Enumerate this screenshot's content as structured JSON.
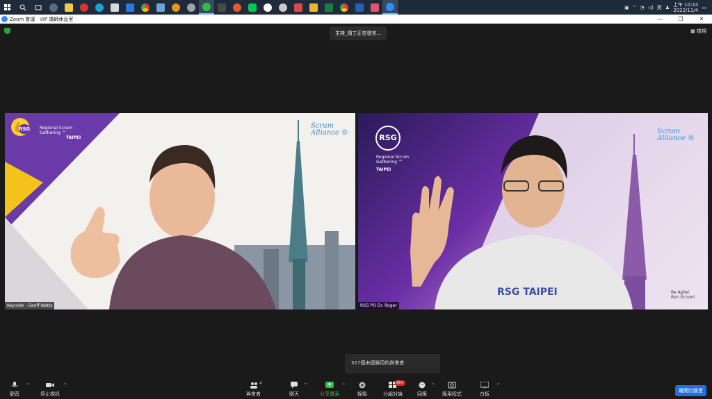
{
  "tray": {
    "time": "上午 10:14",
    "date": "2022/11/4"
  },
  "window": {
    "title": "Zoom 會議 · VIP 講師休息室"
  },
  "meeting": {
    "speaking_toast": "主持_領丁正在發言...",
    "view_label": "檢視",
    "participants": [
      {
        "name": "Keynote - Geoff Watts",
        "brand_line1": "Regional Scrum",
        "brand_line2": "Gathering ™",
        "brand_city": "TAIPEI",
        "logo_text": "RSG"
      },
      {
        "name": "RSG PO Dr. Roger",
        "brand_line1": "Regional Scrum",
        "brand_line2": "Gathering ™",
        "brand_city": "TAIPEI",
        "logo_text": "RSG",
        "slogan1": "Be Agile!",
        "slogan2": "Run Scrum!",
        "shirt_text": "RSG TAIPEI"
      }
    ],
    "partner_logo": {
      "line1": "Scrum",
      "line2": "Alliance ®"
    },
    "unmuted_toast": "327個未經錄用的與會者"
  },
  "toolbar": {
    "mute": "靜音",
    "stop_video": "停止視訊",
    "participants": "與會者",
    "participants_count": "4",
    "chat": "聊天",
    "share": "分享畫面",
    "record": "錄製",
    "breakout": "分組討論",
    "breakout_badge": "99+",
    "reactions": "回應",
    "apps": "應用程式",
    "whiteboard": "白板",
    "end": "離開討論室"
  },
  "colors": {
    "taskbar": "#1f2a3a",
    "zoom_blue": "#2d8cff",
    "share_green": "#26c24a",
    "end_blue": "#1e6fe0",
    "rsg_purple": "#6a3aa8",
    "rsg_yellow": "#f4c21b"
  }
}
